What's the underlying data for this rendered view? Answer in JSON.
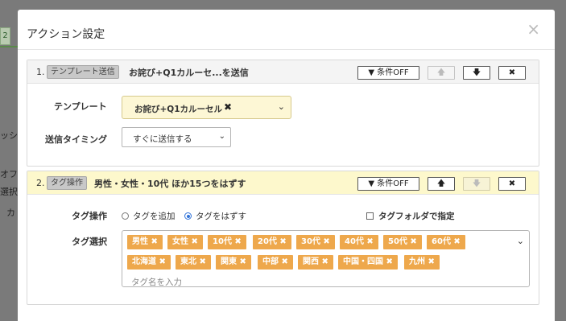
{
  "background": {
    "tab_label": "2",
    "fragments": [
      "ッシ",
      "オフ",
      "選択",
      "カ"
    ]
  },
  "modal": {
    "title": "アクション設定",
    "close_glyph": "×"
  },
  "section1": {
    "number": "1.",
    "type_badge": "テンプレート送信",
    "title": "お詫び+Q1カルーセ...を送信",
    "cond_button": "条件OFF",
    "up_glyph": "🡅",
    "down_glyph": "🡇",
    "delete_glyph": "✖",
    "template_label": "テンプレート",
    "template_value": "お詫び+Q1カルーセル",
    "template_remove": "✖",
    "caret": "⌄",
    "timing_label": "送信タイミング",
    "timing_value": "すぐに送信する"
  },
  "section2": {
    "number": "2.",
    "type_badge": "タグ操作",
    "title": "男性・女性・10代 ほか15つをはずす",
    "cond_button": "条件OFF",
    "up_glyph": "🡅",
    "down_glyph": "🡇",
    "delete_glyph": "✖",
    "op_label": "タグ操作",
    "radio_add": "タグを追加",
    "radio_remove": "タグをはずす",
    "selected_op": "remove",
    "folder_checkbox": "タグフォルダで指定",
    "select_label": "タグ選択",
    "tags": [
      "男性 ✖",
      "女性 ✖",
      "10代 ✖",
      "20代 ✖",
      "30代 ✖",
      "40代 ✖",
      "50代 ✖",
      "60代 ✖",
      "北海道 ✖",
      "東北 ✖",
      "関東 ✖",
      "中部 ✖",
      "関西 ✖",
      "中国・四国 ✖",
      "九州 ✖"
    ],
    "placeholder": "タグ名を入力",
    "caret": "⌄"
  },
  "colors": {
    "tag_bg": "#eea84c",
    "section2_header": "#fdf8cc",
    "template_select_bg": "#fdf7d5",
    "radio_accent": "#2f72d8"
  }
}
